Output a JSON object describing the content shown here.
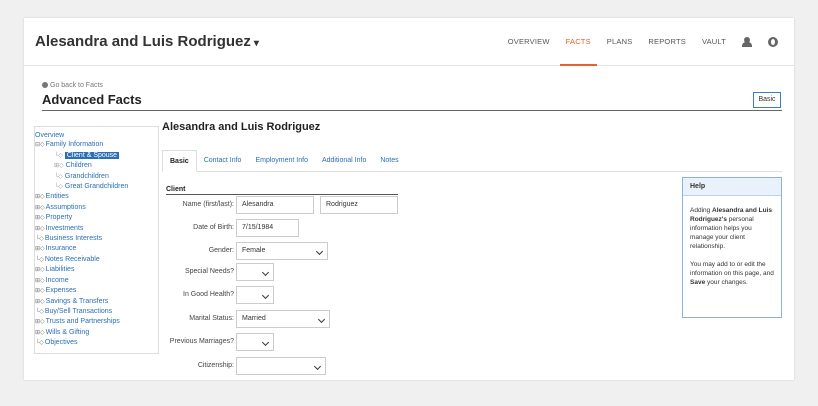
{
  "header": {
    "client_title": "Alesandra and Luis Rodriguez",
    "caret": "▾",
    "nav": [
      "OVERVIEW",
      "FACTS",
      "PLANS",
      "REPORTS",
      "VAULT"
    ],
    "active_nav": "FACTS",
    "icons": [
      "user-icon",
      "globe-icon"
    ],
    "accent_color": "#e4622b"
  },
  "page": {
    "back_link": "Go back to Facts",
    "title": "Advanced Facts",
    "basic_button": "Basic"
  },
  "tree": {
    "items": [
      {
        "label": "Overview",
        "level": 0,
        "prefix": ""
      },
      {
        "label": "Family Information",
        "level": 0,
        "prefix": "⊟◇"
      },
      {
        "label": "Client & Spouse",
        "level": 1,
        "prefix": "└◇",
        "selected": true
      },
      {
        "label": "Children",
        "level": 1,
        "prefix": "⊞◇"
      },
      {
        "label": "Grandchildren",
        "level": 1,
        "prefix": "└◇"
      },
      {
        "label": "Great Grandchildren",
        "level": 1,
        "prefix": "└◇"
      },
      {
        "label": "Entities",
        "level": 0,
        "prefix": "⊞◇"
      },
      {
        "label": "Assumptions",
        "level": 0,
        "prefix": "⊞◇"
      },
      {
        "label": "Property",
        "level": 0,
        "prefix": "⊞◇"
      },
      {
        "label": "Investments",
        "level": 0,
        "prefix": "⊞◇"
      },
      {
        "label": "Business Interests",
        "level": 0,
        "prefix": "└◇"
      },
      {
        "label": "Insurance",
        "level": 0,
        "prefix": "⊞◇"
      },
      {
        "label": "Notes Receivable",
        "level": 0,
        "prefix": "└◇"
      },
      {
        "label": "Liabilities",
        "level": 0,
        "prefix": "⊞◇"
      },
      {
        "label": "Income",
        "level": 0,
        "prefix": "⊞◇"
      },
      {
        "label": "Expenses",
        "level": 0,
        "prefix": "⊞◇"
      },
      {
        "label": "Savings & Transfers",
        "level": 0,
        "prefix": "⊞◇"
      },
      {
        "label": "Buy/Sell Transactions",
        "level": 0,
        "prefix": "└◇"
      },
      {
        "label": "Trusts and Partnerships",
        "level": 0,
        "prefix": "⊞◇"
      },
      {
        "label": "Wills & Gifting",
        "level": 0,
        "prefix": "⊞◇"
      },
      {
        "label": "Objectives",
        "level": 0,
        "prefix": "└◇"
      }
    ]
  },
  "main": {
    "client_name": "Alesandra and Luis Rodriguez",
    "tabs": [
      "Basic",
      "Contact Info",
      "Employment Info",
      "Additional Info",
      "Notes"
    ],
    "active_tab": "Basic",
    "section_title": "Client",
    "fields": {
      "name_label": "Name (first/last):",
      "first_name": "Alesandra",
      "last_name": "Rodriguez",
      "dob_label": "Date of Birth:",
      "dob": "7/15/1984",
      "gender_label": "Gender:",
      "gender": "Female",
      "special_needs_label": "Special Needs?",
      "special_needs": "",
      "good_health_label": "In Good Health?",
      "good_health": "",
      "marital_label": "Marital Status:",
      "marital": "Married",
      "prev_marriages_label": "Previous Marriages?",
      "prev_marriages": "",
      "citizenship_label": "Citizenship:",
      "citizenship": ""
    }
  },
  "help": {
    "title": "Help",
    "p1_a": "Adding ",
    "p1_b": "Alesandra and Luis Rodriguez's",
    "p1_c": " personal information helps you manage your client relationship.",
    "p2_a": "You may add to or edit the information on this page, and ",
    "p2_b": "Save",
    "p2_c": " your changes."
  }
}
